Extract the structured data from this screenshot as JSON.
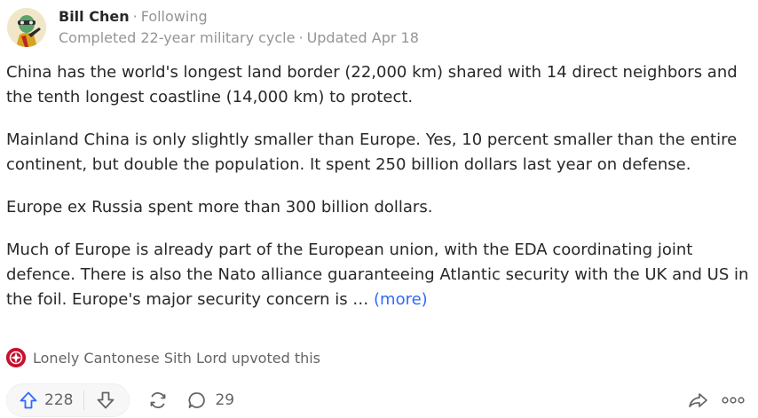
{
  "header": {
    "author": "Bill Chen",
    "separator": "·",
    "follow_status": "Following",
    "credential": "Completed 22-year military cycle",
    "credential_separator": "·",
    "updated": "Updated Apr 18"
  },
  "body": {
    "paragraphs": [
      "China has the world's longest land border (22,000 km) shared with 14 direct neighbors and the tenth longest coastline (14,000 km) to protect.",
      "Mainland China is only slightly smaller than Europe. Yes, 10 percent smaller than the entire continent, but double the population. It spent 250 billion dollars last year on defense.",
      "Europe ex Russia spent more than 300 billion dollars.",
      "Much of Europe is already part of the European union, with the EDA coordinating joint defence. There is also the Nato alliance guaranteeing Atlantic security with the UK and US in the foil. Europe's major security concern is …"
    ],
    "more_label": "(more)"
  },
  "upvoted_by": {
    "text": "Lonely Cantonese Sith Lord upvoted this"
  },
  "actions": {
    "upvotes": "228",
    "comments": "29"
  },
  "colors": {
    "link": "#2e69ff",
    "text": "#282829",
    "muted": "#939598",
    "icon": "#636466",
    "upvote_accent": "#2e69ff"
  },
  "icons": {
    "upvote": "upvote-arrow-icon",
    "downvote": "downvote-arrow-icon",
    "share": "reshare-icon",
    "comment": "comment-bubble-icon",
    "forward": "share-forward-icon",
    "more": "more-dots-icon"
  }
}
